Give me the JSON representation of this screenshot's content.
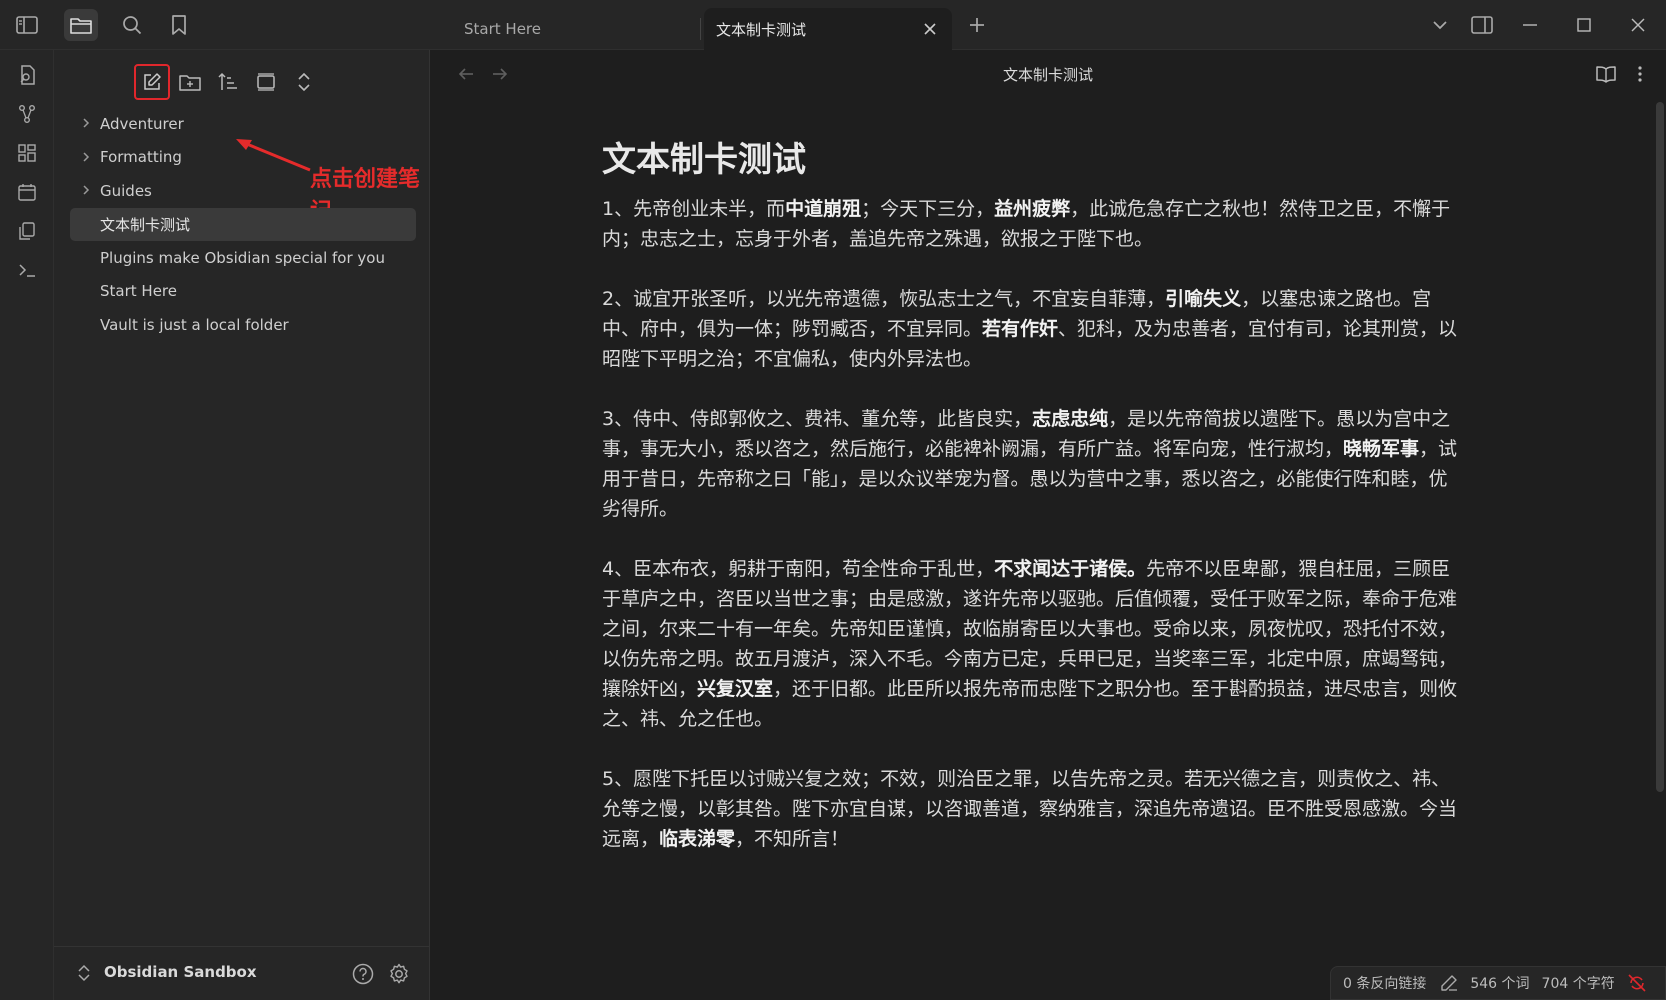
{
  "topbar": {
    "tabs": [
      {
        "title": "Start Here",
        "active": false
      },
      {
        "title": "文本制卡测试",
        "active": true
      }
    ]
  },
  "sidebar": {
    "tree": [
      {
        "label": "Adventurer",
        "folder": true
      },
      {
        "label": "Formatting",
        "folder": true
      },
      {
        "label": "Guides",
        "folder": true
      },
      {
        "label": "文本制卡测试",
        "folder": false,
        "selected": true
      },
      {
        "label": "Plugins make Obsidian special for you",
        "folder": false
      },
      {
        "label": "Start Here",
        "folder": false
      },
      {
        "label": "Vault is just a local folder",
        "folder": false
      }
    ],
    "annotation": "点击创建笔记",
    "vault_name": "Obsidian Sandbox"
  },
  "main": {
    "header_title": "文本制卡测试",
    "heading": "文本制卡测试",
    "paragraphs": [
      [
        {
          "t": "1、先帝创业未半，而"
        },
        {
          "t": "中道崩殂",
          "b": true
        },
        {
          "t": "；今天下三分，"
        },
        {
          "t": "益州疲弊",
          "b": true
        },
        {
          "t": "，此诚危急存亡之秋也！然侍卫之臣，不懈于内；忠志之士，忘身于外者，盖追先帝之殊遇，欲报之于陛下也。"
        }
      ],
      [
        {
          "t": "2、诚宜开张圣听，以光先帝遗德，恢弘志士之气，不宜妄自菲薄，"
        },
        {
          "t": "引喻失义",
          "b": true
        },
        {
          "t": "，以塞忠谏之路也。宫中、府中，俱为一体；陟罚臧否，不宜异同。"
        },
        {
          "t": "若有作奸",
          "b": true
        },
        {
          "t": "、犯科，及为忠善者，宜付有司，论其刑赏，以昭陛下平明之治；不宜偏私，使内外异法也。"
        }
      ],
      [
        {
          "t": "3、侍中、侍郎郭攸之、费祎、董允等，此皆良实，"
        },
        {
          "t": "志虑忠纯",
          "b": true
        },
        {
          "t": "，是以先帝简拔以遗陛下。愚以为宫中之事，事无大小，悉以咨之，然后施行，必能裨补阙漏，有所广益。将军向宠，性行淑均，"
        },
        {
          "t": "晓畅军事",
          "b": true
        },
        {
          "t": "，试用于昔日，先帝称之曰「能」，是以众议举宠为督。愚以为营中之事，悉以咨之，必能使行阵和睦，优劣得所。"
        }
      ],
      [
        {
          "t": "4、臣本布衣，躬耕于南阳，苟全性命于乱世，"
        },
        {
          "t": "不求闻达于诸侯。",
          "b": true
        },
        {
          "t": "先帝不以臣卑鄙，猥自枉屈，三顾臣于草庐之中，咨臣以当世之事；由是感激，遂许先帝以驱驰。后值倾覆，受任于败军之际，奉命于危难之间，尔来二十有一年矣。先帝知臣谨慎，故临崩寄臣以大事也。受命以来，夙夜忧叹，恐托付不效，以伤先帝之明。故五月渡泸，深入不毛。今南方已定，兵甲已足，当奖率三军，北定中原，庶竭驽钝，攘除奸凶，"
        },
        {
          "t": "兴复汉室",
          "b": true
        },
        {
          "t": "，还于旧都。此臣所以报先帝而忠陛下之职分也。至于斟酌损益，进尽忠言，则攸之、祎、允之任也。"
        }
      ],
      [
        {
          "t": "5、愿陛下托臣以讨贼兴复之效；不效，则治臣之罪，以告先帝之灵。若无兴德之言，则责攸之、祎、允等之慢，以彰其咎。陛下亦宜自谋，以咨诹善道，察纳雅言，深追先帝遗诏。臣不胜受恩感激。今当远离，"
        },
        {
          "t": "临表涕零",
          "b": true
        },
        {
          "t": "，不知所言！"
        }
      ]
    ]
  },
  "status": {
    "backlinks": "0 条反向链接",
    "words": "546 个词",
    "chars": "704 个字符"
  },
  "icons": {
    "ribbon": [
      "open-quick-switcher-icon",
      "graph-view-icon",
      "canvas-icon",
      "daily-note-icon",
      "templates-icon",
      "command-palette-icon"
    ],
    "accent_red": "#e0272c"
  }
}
